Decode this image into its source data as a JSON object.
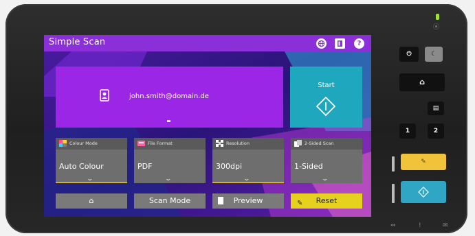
{
  "app": {
    "title": "Simple Scan"
  },
  "titlebar_icons": [
    "globe-icon",
    "book-icon",
    "help-icon"
  ],
  "destination": {
    "email": "john.smith@domain.de"
  },
  "start_button": {
    "label": "Start"
  },
  "settings": [
    {
      "label": "Colour Mode",
      "value": "Auto Colour"
    },
    {
      "label": "File Format",
      "value": "PDF"
    },
    {
      "label": "Resolution",
      "value": "300dpi"
    },
    {
      "label": "2-Sided Scan",
      "value": "1-Sided"
    }
  ],
  "bottom_buttons": {
    "home": "⌂",
    "scan_mode": "Scan Mode",
    "preview": "Preview",
    "reset": "Reset"
  },
  "hardware": {
    "copy_1": "1",
    "copy_2": "2"
  },
  "colors": {
    "accent_purple": "#9b26e6",
    "titlebar": "#8b2fd9",
    "start_teal": "#1fa7bd",
    "reset_yellow": "#e6d21e",
    "hardware_yellow": "#f1c33a",
    "hardware_teal": "#2ea6c4"
  }
}
